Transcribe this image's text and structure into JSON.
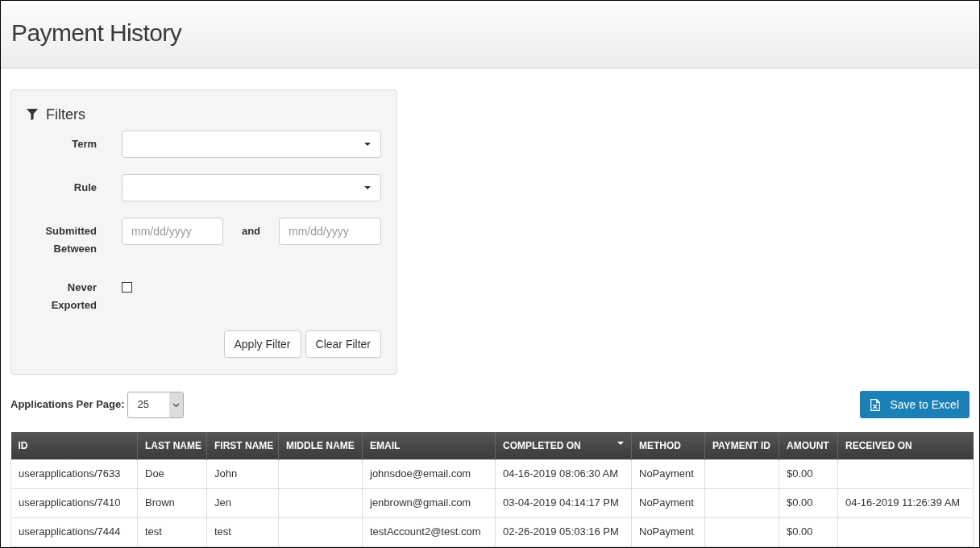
{
  "page": {
    "title": "Payment History"
  },
  "filters": {
    "title": "Filters",
    "fields": [
      {
        "kind": "select",
        "label": "Term"
      },
      {
        "kind": "select",
        "label": "Rule"
      },
      {
        "kind": "date_range",
        "label": "Submitted Between",
        "from": {
          "placeholder": "mm/dd/yyyy"
        },
        "joiner": "and",
        "to": {
          "placeholder": "mm/dd/yyyy"
        }
      },
      {
        "kind": "checkbox",
        "label": "Never Exported",
        "checked": false
      }
    ],
    "buttons": [
      "Apply Filter",
      "Clear Filter"
    ]
  },
  "per_page": {
    "label": "Applications Per Page:",
    "value": "25"
  },
  "export_button": {
    "label": "Save to Excel"
  },
  "table": {
    "columns": [
      {
        "label": "ID",
        "sorted": false
      },
      {
        "label": "LAST NAME",
        "sorted": false
      },
      {
        "label": "FIRST NAME",
        "sorted": false
      },
      {
        "label": "MIDDLE NAME",
        "sorted": false
      },
      {
        "label": "EMAIL",
        "sorted": false
      },
      {
        "label": "COMPLETED ON",
        "sorted": true
      },
      {
        "label": "METHOD",
        "sorted": false
      },
      {
        "label": "PAYMENT ID",
        "sorted": false
      },
      {
        "label": "AMOUNT",
        "sorted": false
      },
      {
        "label": "RECEIVED ON",
        "sorted": false
      }
    ],
    "rows": [
      {
        "id": "userapplications/7633",
        "last_name": "Doe",
        "first_name": "John",
        "email": "johnsdoe@email.com",
        "completed_on": "04-16-2019 08:06:30 AM",
        "method": "NoPayment",
        "amount": "$0.00"
      },
      {
        "id": "userapplications/7410",
        "last_name": "Brown",
        "first_name": "Jen",
        "email": "jenbrown@gmail.com",
        "completed_on": "03-04-2019 04:14:17 PM",
        "method": "NoPayment",
        "amount": "$0.00",
        "received_on": "04-16-2019 11:26:39 AM"
      },
      {
        "id": "userapplications/7444",
        "last_name": "test",
        "first_name": "test",
        "email": "testAccount2@test.com",
        "completed_on": "02-26-2019 05:03:16 PM",
        "method": "NoPayment",
        "amount": "$0.00"
      }
    ]
  }
}
